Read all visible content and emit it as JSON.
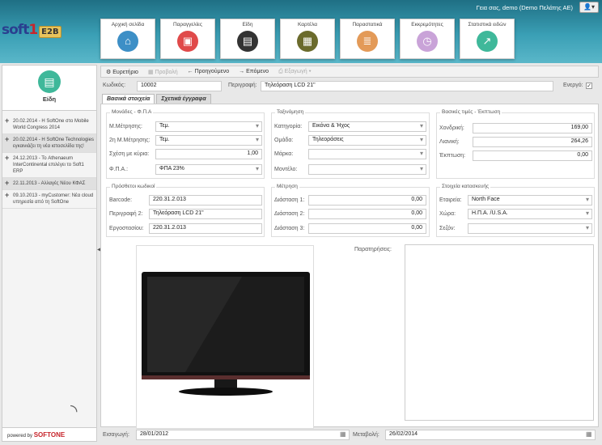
{
  "header": {
    "greeting": "Γεια σας, demo (Demo Πελάτης ΑΕ)",
    "user_menu": "👤▾",
    "logo_a": "soft",
    "logo_b": "1",
    "logo_c": "E2B"
  },
  "modules": [
    {
      "label": "Αρχική σελίδα",
      "icon": "home-icon",
      "glyph": "⌂",
      "color": "#3d8fc6"
    },
    {
      "label": "Παραγγελίες",
      "icon": "bag-icon",
      "glyph": "▣",
      "color": "#e04a4a"
    },
    {
      "label": "Είδη",
      "icon": "cabinet-icon",
      "glyph": "▤",
      "color": "#333333"
    },
    {
      "label": "Καρτέλα",
      "icon": "document-icon",
      "glyph": "▦",
      "color": "#6b6b2c"
    },
    {
      "label": "Παραστατικά",
      "icon": "invoice-icon",
      "glyph": "≣",
      "color": "#e39a58"
    },
    {
      "label": "Εκκρεμότητες",
      "icon": "clock-icon",
      "glyph": "◷",
      "color": "#c9a3d8"
    },
    {
      "label": "Στατιστικά ειδών",
      "icon": "chart-icon",
      "glyph": "↗",
      "color": "#3fb89a"
    }
  ],
  "sidebar": {
    "title": "Είδη",
    "news": [
      {
        "text": "20.02.2014 - Η SoftOne στο Mobile World Congress 2014"
      },
      {
        "text": "20.02.2014 - Η SoftOne Technologies εγκαινιάζει τη νέα ιστοσελίδα της!"
      },
      {
        "text": "24.12.2013 - Το Athenaeum InterContinental επιλέγει το Soft1 ERP"
      },
      {
        "text": "22.11.2013 - Αλλαγές Νέου ΚΦΑΣ"
      },
      {
        "text": "09.10.2013 - myCustomer: Νέα cloud υπηρεσία από τη SoftOne"
      }
    ],
    "powered_by": "powered by",
    "powered_brand": "SOFTONE"
  },
  "toolbar": {
    "search": "Ευρετήριο",
    "view": "Προβολή",
    "prev": "Προηγούμενο",
    "next": "Επόμενο",
    "print": "Εξαγωγή"
  },
  "record": {
    "code_label": "Κωδικός:",
    "code": "10002",
    "desc_label": "Περιγραφή:",
    "desc": "Τηλεόραση LCD 21\"",
    "active_label": "Ενεργό:"
  },
  "tabs": [
    "Βασικά στοιχεία",
    "Σχετικά έγγραφα"
  ],
  "units": {
    "title": "Μονάδες - Φ.Π.Α",
    "unit_label": "Μ.Μέτρησης:",
    "unit": "Τεμ.",
    "unit2_label": "2η Μ.Μέτρησης:",
    "unit2": "Τεμ.",
    "ratio_label": "Σχέση με κύρια:",
    "ratio": "1,00",
    "vat_label": "Φ.Π.Α.:",
    "vat": "ΦΠΑ 23%"
  },
  "classification": {
    "title": "Ταξινόμηση",
    "cat_label": "Κατηγορία:",
    "cat": "Εικόνα & Ήχος",
    "group_label": "Ομάδα:",
    "group": "Τηλεοράσεις",
    "brand_label": "Μάρκα:",
    "brand": "",
    "model_label": "Μοντέλο:",
    "model": ""
  },
  "prices": {
    "title": "Βασικές τιμές - Έκπτωση",
    "wholesale_label": "Χονδρική:",
    "wholesale": "169,00",
    "retail_label": "Λιανική:",
    "retail": "264,26",
    "discount_label": "Έκπτωση:",
    "discount": "0,00"
  },
  "codes": {
    "title": "Πρόσθετοι κωδικοί",
    "barcode_label": "Barcode:",
    "barcode": "220.31.2.013",
    "desc2_label": "Περιγραφή 2:",
    "desc2": "Τηλεόραση LCD 21\"",
    "factory_label": "Εργοστασίου:",
    "factory": "220.31.2.013"
  },
  "measure": {
    "title": "Μέτρηση",
    "d1_label": "Διάσταση 1:",
    "d1": "0,00",
    "d2_label": "Διάσταση 2:",
    "d2": "0,00",
    "d3_label": "Διάσταση 3:",
    "d3": "0,00"
  },
  "manufacture": {
    "title": "Στοιχεία κατασκευής",
    "company_label": "Εταιρεία:",
    "company": "North Face",
    "country_label": "Χώρα:",
    "country": "Η.Π.Α. /U.S.A.",
    "season_label": "Σεζόν:",
    "season": ""
  },
  "notes_label": "Παρατηρήσεις:",
  "footer": {
    "insert_label": "Εισαγωγή:",
    "insert_date": "28/01/2012",
    "modify_label": "Μεταβολή:",
    "modify_date": "26/02/2014"
  }
}
